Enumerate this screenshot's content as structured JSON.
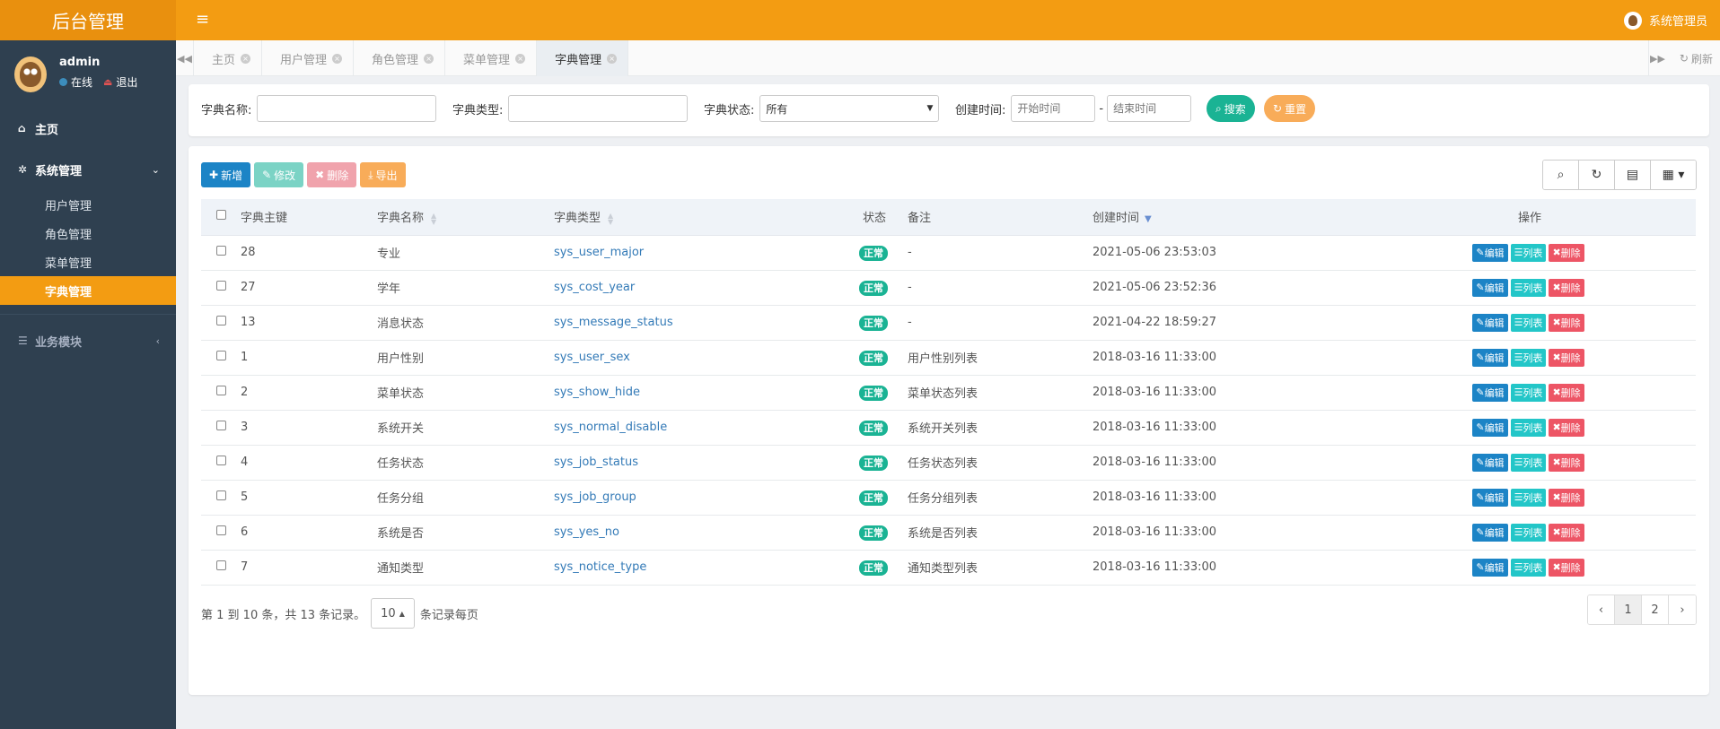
{
  "header": {
    "brand": "后台管理",
    "menu_icon": "hamburger-icon",
    "user_label": "系统管理员"
  },
  "sidebar": {
    "user": {
      "name": "admin",
      "status": "在线",
      "logout": "退出"
    },
    "home": "主页",
    "system": "系统管理",
    "items": [
      "用户管理",
      "角色管理",
      "菜单管理",
      "字典管理"
    ],
    "business": "业务模块"
  },
  "tabs": [
    "主页",
    "用户管理",
    "角色管理",
    "菜单管理",
    "字典管理"
  ],
  "refresh_label": "刷新",
  "search": {
    "name_label": "字典名称:",
    "type_label": "字典类型:",
    "status_label": "字典状态:",
    "status_value": "所有",
    "created_label": "创建时间:",
    "start_placeholder": "开始时间",
    "end_placeholder": "结束时间",
    "dash": "-",
    "search_btn": "搜索",
    "reset_btn": "重置"
  },
  "toolbar": {
    "add": "新增",
    "edit": "修改",
    "delete": "删除",
    "export": "导出"
  },
  "table": {
    "headers": [
      "字典主键",
      "字典名称",
      "字典类型",
      "状态",
      "备注",
      "创建时间",
      "操作"
    ],
    "status_text": "正常",
    "action_edit": "编辑",
    "action_list": "列表",
    "action_delete": "删除",
    "rows": [
      {
        "id": "28",
        "name": "专业",
        "type": "sys_user_major",
        "remark": "-",
        "created": "2021-05-06 23:53:03"
      },
      {
        "id": "27",
        "name": "学年",
        "type": "sys_cost_year",
        "remark": "-",
        "created": "2021-05-06 23:52:36"
      },
      {
        "id": "13",
        "name": "消息状态",
        "type": "sys_message_status",
        "remark": "-",
        "created": "2021-04-22 18:59:27"
      },
      {
        "id": "1",
        "name": "用户性别",
        "type": "sys_user_sex",
        "remark": "用户性别列表",
        "created": "2018-03-16 11:33:00"
      },
      {
        "id": "2",
        "name": "菜单状态",
        "type": "sys_show_hide",
        "remark": "菜单状态列表",
        "created": "2018-03-16 11:33:00"
      },
      {
        "id": "3",
        "name": "系统开关",
        "type": "sys_normal_disable",
        "remark": "系统开关列表",
        "created": "2018-03-16 11:33:00"
      },
      {
        "id": "4",
        "name": "任务状态",
        "type": "sys_job_status",
        "remark": "任务状态列表",
        "created": "2018-03-16 11:33:00"
      },
      {
        "id": "5",
        "name": "任务分组",
        "type": "sys_job_group",
        "remark": "任务分组列表",
        "created": "2018-03-16 11:33:00"
      },
      {
        "id": "6",
        "name": "系统是否",
        "type": "sys_yes_no",
        "remark": "系统是否列表",
        "created": "2018-03-16 11:33:00"
      },
      {
        "id": "7",
        "name": "通知类型",
        "type": "sys_notice_type",
        "remark": "通知类型列表",
        "created": "2018-03-16 11:33:00"
      }
    ]
  },
  "pagination": {
    "info": "第 1 到 10 条，共 13 条记录。",
    "page_size": "10",
    "per_page_suffix": "条记录每页",
    "prev": "‹",
    "pages": [
      "1",
      "2"
    ],
    "next": "›"
  },
  "colors": {
    "accent": "#f39c12",
    "sidebar": "#2f4050",
    "primary": "#1c84c6",
    "success": "#1ab394",
    "danger": "#ed5565",
    "info": "#23c6c8",
    "warning": "#f8ac59"
  }
}
